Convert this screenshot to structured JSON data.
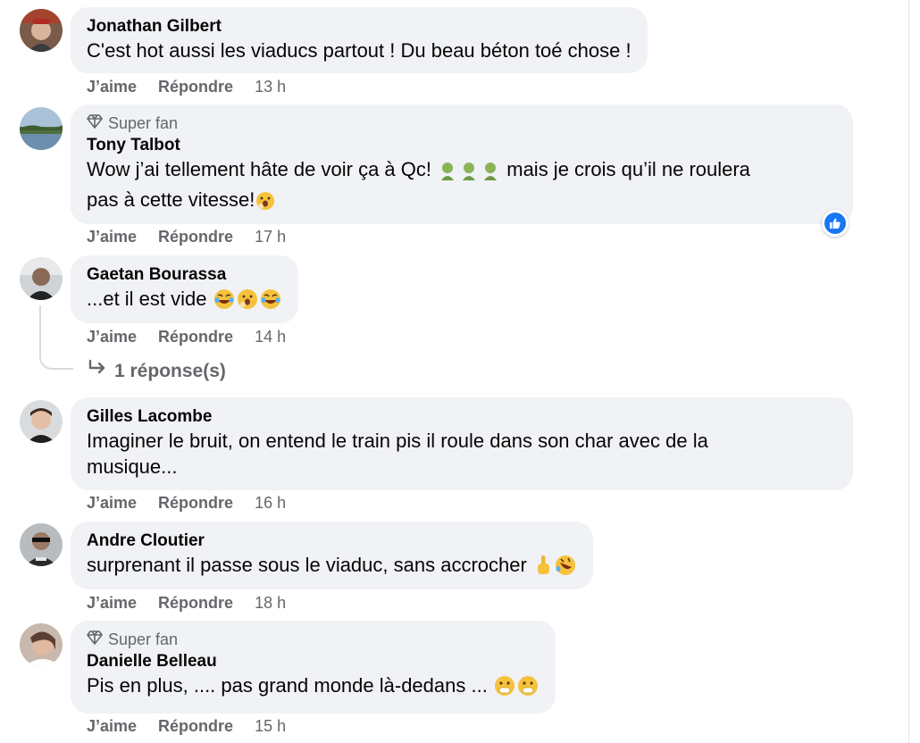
{
  "comments": [
    {
      "author": "Jonathan Gilbert",
      "badge": "",
      "text": "C'est hot aussi les viaducs partout ! Du beau béton toé chose !",
      "like_label": "J’aime",
      "reply_label": "Répondre",
      "time": "13 h"
    },
    {
      "author": "Tony Talbot",
      "badge": "Super fan",
      "text_line1": "Wow j’ai tellement hâte de voir ça à Qc!",
      "text_line1b": "mais je crois qu’il ne roulera",
      "text_line2": "pas à cette vitesse!",
      "like_label": "J’aime",
      "reply_label": "Répondre",
      "time": "17 h",
      "reaction_icon": "like-reaction-icon"
    },
    {
      "author": "Gaetan Bourassa",
      "badge": "",
      "text": "...et il est vide",
      "like_label": "J’aime",
      "reply_label": "Répondre",
      "time": "14 h",
      "replies_label": "1 réponse(s)"
    },
    {
      "author": "Gilles Lacombe",
      "badge": "",
      "text_line1": "Imaginer le bruit, on entend le train pis il roule dans son char avec de la",
      "text_line2": "musique...",
      "like_label": "J’aime",
      "reply_label": "Répondre",
      "time": "16 h"
    },
    {
      "author": "Andre Cloutier",
      "badge": "",
      "text": "surprenant il passe sous le viaduc, sans accrocher",
      "like_label": "J’aime",
      "reply_label": "Répondre",
      "time": "18 h"
    },
    {
      "author": "Danielle Belleau",
      "badge": "Super fan",
      "text": "Pis en plus, .... pas grand monde là-dedans ...",
      "like_label": "J’aime",
      "reply_label": "Répondre",
      "time": "15 h"
    }
  ],
  "colors": {
    "bubble": "#f0f2f5",
    "muted": "#65676b",
    "like_blue": "#1877f2"
  }
}
